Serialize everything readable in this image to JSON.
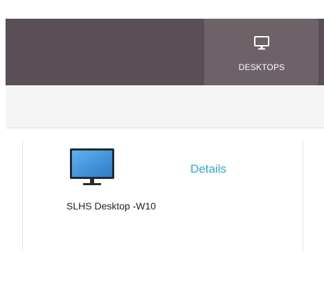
{
  "nav": {
    "tabs": [
      {
        "label": "DESKTOPS",
        "icon": "monitor-icon",
        "active": true
      }
    ]
  },
  "desktops": [
    {
      "name": "SLHS Desktop -W10",
      "action_label": "Details",
      "icon": "desktop-monitor-icon"
    }
  ],
  "colors": {
    "nav_background": "#5b4f57",
    "active_tab": "#6e6269",
    "subbar_background": "#f5f5f5",
    "link": "#2ba9c9",
    "monitor_screen": "#3e8fd8"
  }
}
